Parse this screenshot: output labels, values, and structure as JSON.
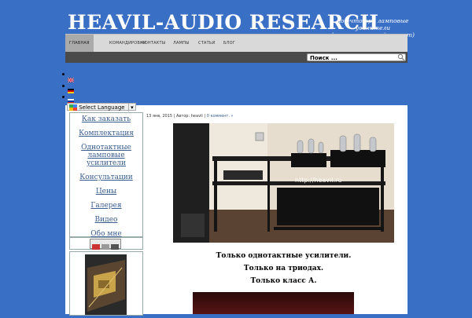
{
  "header": {
    "site_title": "HEAVIL-AUDIO RESEARCH",
    "tagline": "кое-что про ламповые усилители (некоммерческий проект)"
  },
  "nav": {
    "items": [
      {
        "label": "ГЛАВНАЯ"
      },
      {
        "label": "КОМАНДИРОВКИ"
      },
      {
        "label": "КОНТАКТЫ"
      },
      {
        "label": "ЛАМПЫ"
      },
      {
        "label": "СТАТЬИ"
      },
      {
        "label": "БЛОГ"
      }
    ]
  },
  "search": {
    "value": "Поиск ..."
  },
  "language": {
    "select_label": "Select Language",
    "flags": [
      "en",
      "de",
      "ru"
    ]
  },
  "sidebar": {
    "items": [
      {
        "label": "Как заказать"
      },
      {
        "label": "Комплектация"
      },
      {
        "label": "Однотактные ламповые усилители"
      },
      {
        "label": "Консультации"
      },
      {
        "label": "Цены"
      },
      {
        "label": "Галерея"
      },
      {
        "label": "Видео"
      },
      {
        "label": "Обо мне"
      }
    ]
  },
  "post": {
    "date": "13 янв, 2015",
    "author_prefix": "Автор:",
    "author": "heavil",
    "comments": "0 коммент. »",
    "watermark": "http://heavil.ru",
    "lines": [
      "Только однотактные усилители.",
      "Только на триодах.",
      "Только класс А."
    ]
  },
  "colors": {
    "page_bg": "#3a6fc6",
    "link": "#3a5d8f",
    "nav_bg": "#d9d9d9",
    "search_bar_bg": "#4a4a4a"
  }
}
